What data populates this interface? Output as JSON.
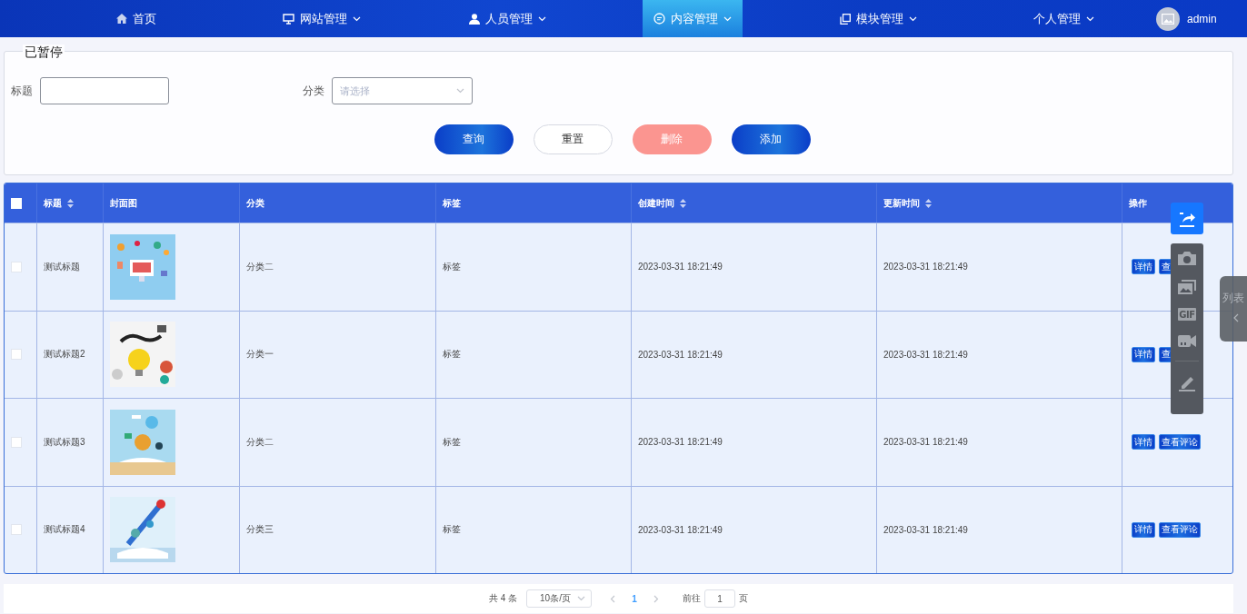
{
  "nav": {
    "items": [
      {
        "label": "首页",
        "dropdown": false,
        "selected": false
      },
      {
        "label": "网站管理",
        "dropdown": true,
        "selected": false
      },
      {
        "label": "人员管理",
        "dropdown": true,
        "selected": false
      },
      {
        "label": "内容管理",
        "dropdown": true,
        "selected": true
      },
      {
        "label": "模块管理",
        "dropdown": true,
        "selected": false
      },
      {
        "label": "个人管理",
        "dropdown": true,
        "selected": false
      }
    ],
    "user": "admin"
  },
  "recorder_status": "已暂停",
  "search": {
    "fields": [
      {
        "kind": "text",
        "label": "标题"
      },
      {
        "kind": "select",
        "label": "分类",
        "placeholder": "请选择"
      }
    ],
    "buttons": [
      {
        "label": "查询",
        "kind": "primary"
      },
      {
        "label": "重置",
        "kind": "plain"
      },
      {
        "label": "删除",
        "kind": "danger"
      },
      {
        "label": "添加",
        "kind": "primary"
      }
    ]
  },
  "table": {
    "select_all_checked": false,
    "columns": [
      {
        "label": "标题",
        "sortable": true
      },
      {
        "label": "封面图",
        "sortable": false
      },
      {
        "label": "分类",
        "sortable": false
      },
      {
        "label": "标签",
        "sortable": false
      },
      {
        "label": "创建时间",
        "sortable": true
      },
      {
        "label": "更新时间",
        "sortable": true
      },
      {
        "label": "操作",
        "sortable": false
      }
    ],
    "rows": [
      {
        "checked": false,
        "title": "测试标题",
        "category": "分类二",
        "tag": "标签",
        "created": "2023-03-31 18:21:49",
        "updated": "2023-03-31 18:21:49",
        "actions": [
          "详情",
          "查"
        ]
      },
      {
        "checked": false,
        "title": "测试标题2",
        "category": "分类一",
        "tag": "标签",
        "created": "2023-03-31 18:21:49",
        "updated": "2023-03-31 18:21:49",
        "actions": [
          "详情",
          "查"
        ]
      },
      {
        "checked": false,
        "title": "测试标题3",
        "category": "分类二",
        "tag": "标签",
        "created": "2023-03-31 18:21:49",
        "updated": "2023-03-31 18:21:49",
        "actions": [
          "详情",
          "查看评论"
        ]
      },
      {
        "checked": false,
        "title": "测试标题4",
        "category": "分类三",
        "tag": "标签",
        "created": "2023-03-31 18:21:49",
        "updated": "2023-03-31 18:21:49",
        "actions": [
          "详情",
          "查看评论"
        ]
      }
    ]
  },
  "pagination": {
    "total": "共 4 条",
    "page_size": "10条/页",
    "pages": [
      {
        "label": "1",
        "selected": true
      }
    ],
    "goto_label": "前往",
    "goto_value": "1",
    "page_suffix": "页"
  },
  "capture_toolbar": {
    "gif_label": "GIF"
  },
  "side_tab": {
    "label": "列表"
  }
}
